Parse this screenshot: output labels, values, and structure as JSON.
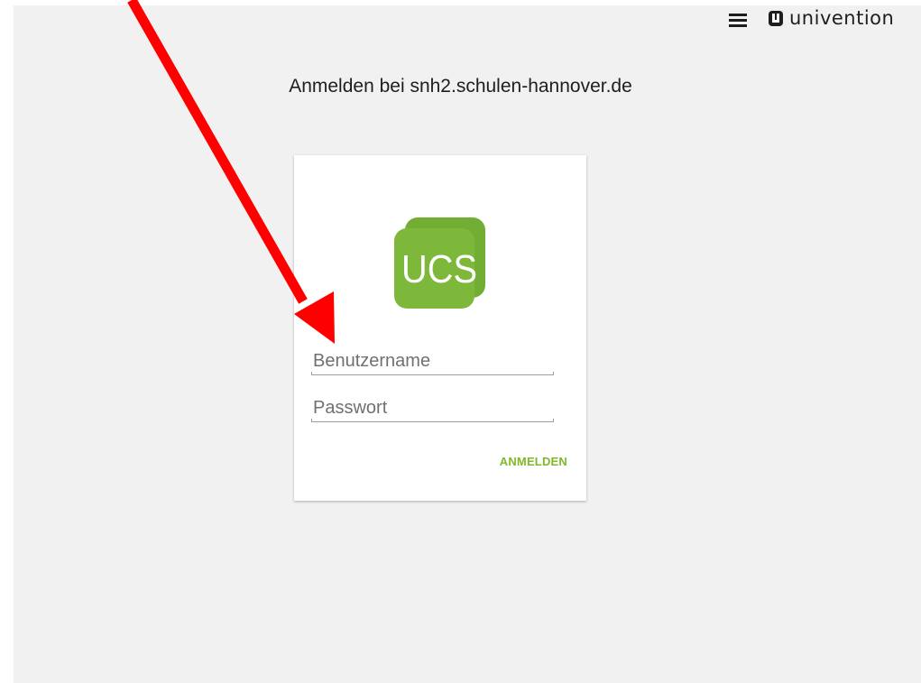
{
  "header": {
    "menu_icon": "hamburger-menu-icon",
    "brand_icon": "univention-logo-icon",
    "brand_name": "univention"
  },
  "page": {
    "title": "Anmelden bei snh2.schulen-hannover.de"
  },
  "login": {
    "logo_text": "UCS",
    "logo_color": "#7db83a",
    "username_placeholder": "Benutzername",
    "password_placeholder": "Passwort",
    "submit_label": "ANMELDEN",
    "accent_color": "#80b828"
  },
  "annotation": {
    "arrow_color": "#ff0000",
    "arrow_icon": "red-arrow-icon"
  }
}
